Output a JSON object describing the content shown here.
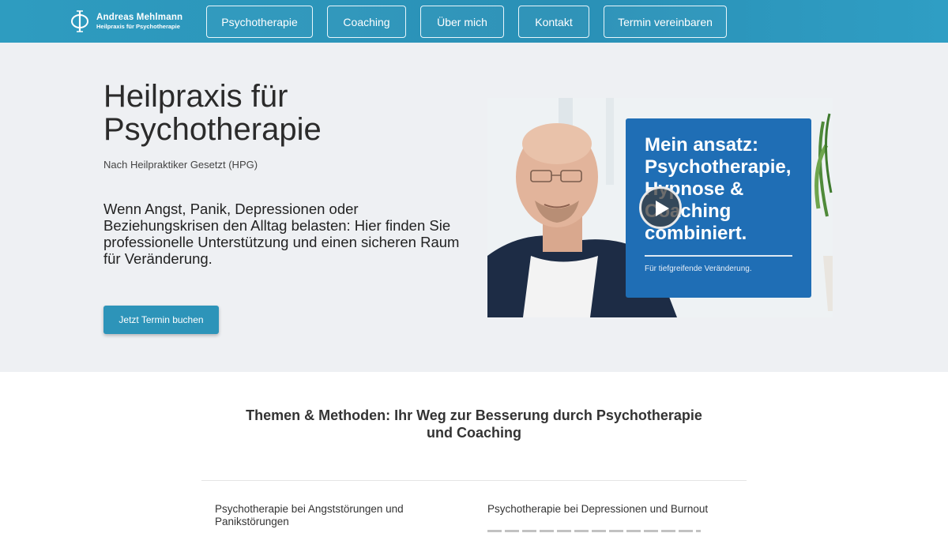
{
  "header": {
    "logo": {
      "name": "Andreas Mehlmann",
      "subtitle": "Heilpraxis für Psychotherapie",
      "mark": "phi-logo-icon"
    },
    "nav": [
      {
        "label": "Psychotherapie"
      },
      {
        "label": "Coaching"
      },
      {
        "label": "Über mich"
      },
      {
        "label": "Kontakt"
      },
      {
        "label": "Termin vereinbaren"
      }
    ]
  },
  "hero": {
    "title": "Heilpraxis für Psychotherapie",
    "subtitle": "Nach Heilpraktiker Gesetzt (HPG)",
    "lead": "Wenn Angst, Panik, Depressionen oder Beziehungskrisen den Alltag belasten: Hier finden Sie professionelle Unterstützung und einen sicheren Raum für Veränderung.",
    "cta_label": "Jetzt Termin buchen",
    "video": {
      "overlay_title": "Mein ansatz: Psychotherapie, Hypnose & Coaching combiniert.",
      "overlay_footer": "Für tiefgreifende Veränderung.",
      "play_icon": "play-icon"
    }
  },
  "section": {
    "title": "Themen & Methoden: Ihr Weg zur Besserung durch Psychotherapie und Coaching",
    "topics": [
      {
        "title": "Psychotherapie bei Angststörungen und Panikstörungen"
      },
      {
        "title": "Psychotherapie bei Depressionen und Burnout"
      }
    ]
  },
  "colors": {
    "header": "#2e9cc0",
    "hero_bg": "#eef0f3",
    "cta": "#2d94b9",
    "overlay": "#1f6eb5"
  }
}
